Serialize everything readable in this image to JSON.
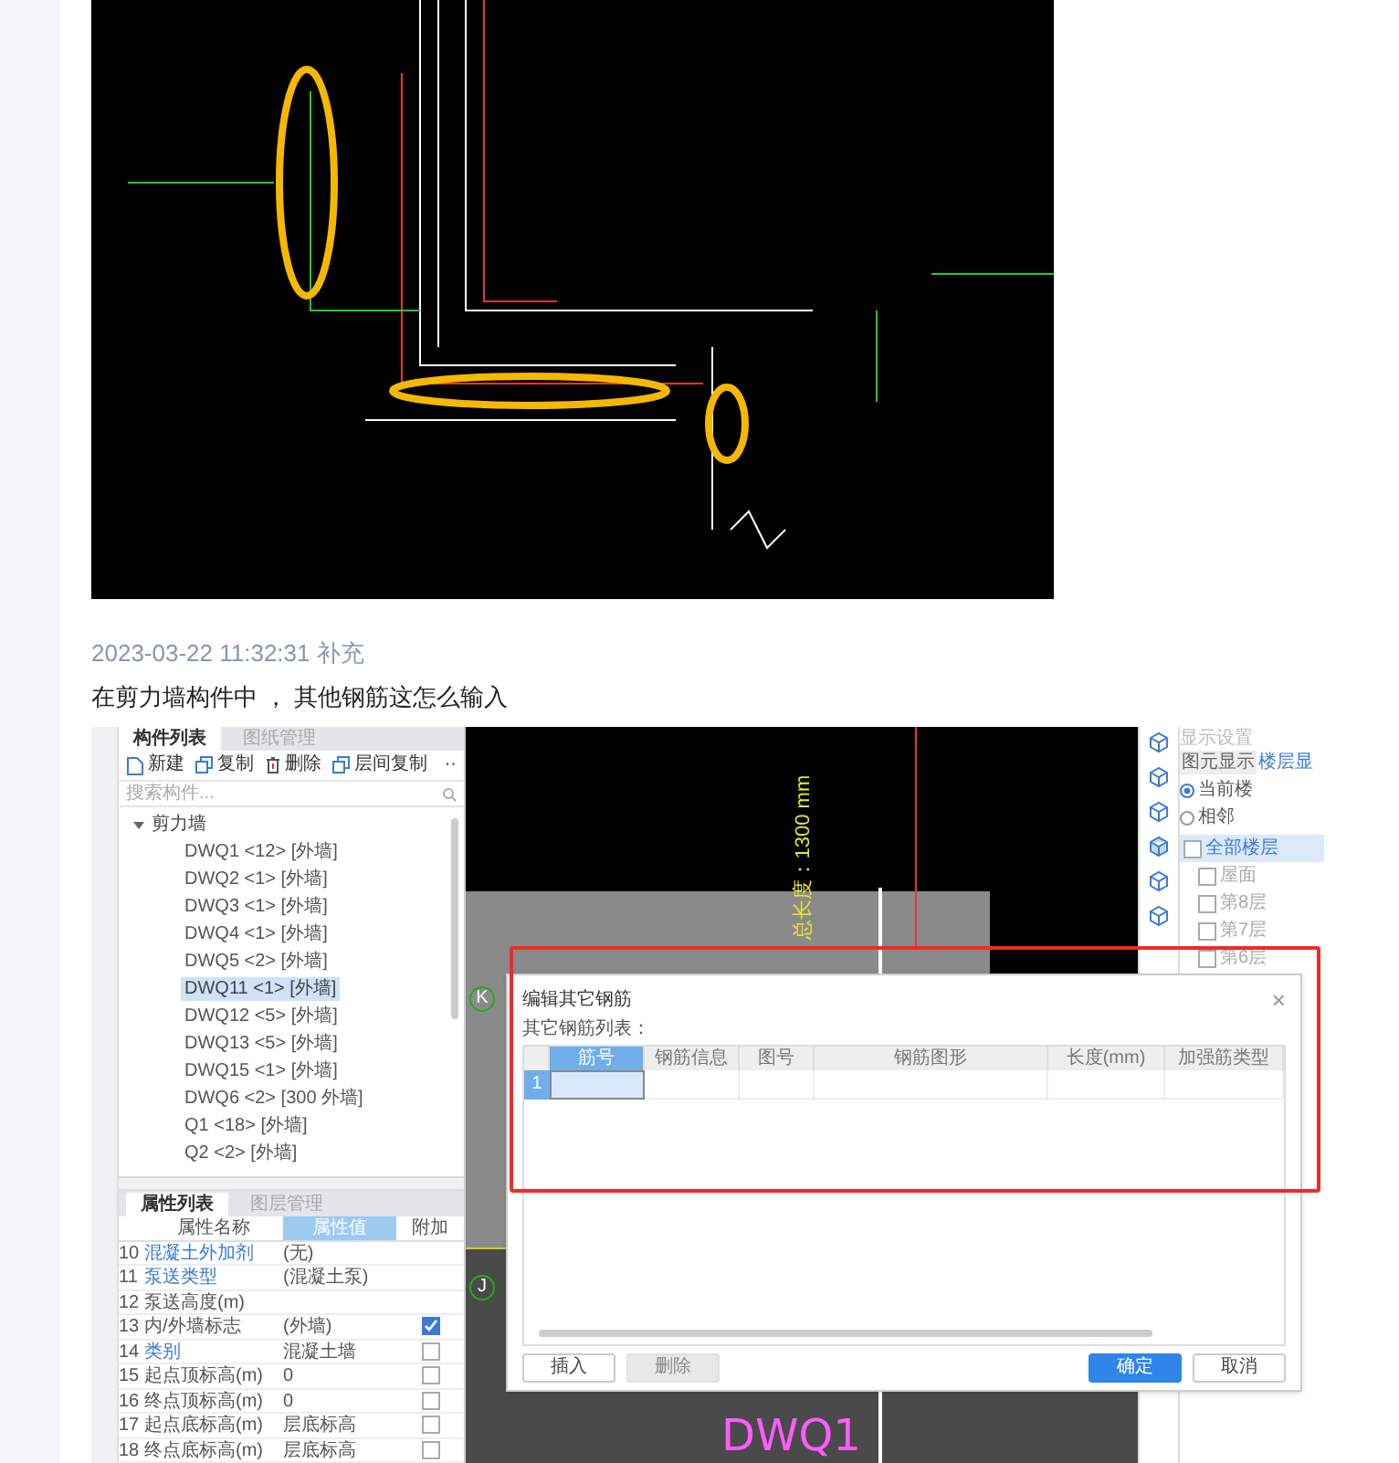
{
  "post": {
    "timestamp": "2023-03-22 11:32:31 补充",
    "question": "在剪力墙构件中 ， 其他钢筋这怎么输入"
  },
  "screenshot": {
    "left_tabs": [
      {
        "label": "构件列表",
        "selected": true
      },
      {
        "label": "图纸管理",
        "selected": false
      }
    ],
    "toolbar": [
      {
        "kind": "new",
        "label": "新建"
      },
      {
        "kind": "copy",
        "label": "复制"
      },
      {
        "kind": "delete",
        "label": "删除"
      },
      {
        "kind": "floor-copy",
        "label": "层间复制"
      },
      {
        "kind": "more",
        "label": "··"
      }
    ],
    "search": {
      "placeholder": "搜索构件..."
    },
    "tree": {
      "label": "剪力墙",
      "expanded": true,
      "children": [
        {
          "label": "DWQ1 <12> [外墙]",
          "selected": false
        },
        {
          "label": "DWQ2 <1> [外墙]",
          "selected": false
        },
        {
          "label": "DWQ3 <1> [外墙]",
          "selected": false
        },
        {
          "label": "DWQ4 <1> [外墙]",
          "selected": false
        },
        {
          "label": "DWQ5 <2> [外墙]",
          "selected": false
        },
        {
          "label": "DWQ11 <1> [外墙]",
          "selected": true
        },
        {
          "label": "DWQ12 <5> [外墙]",
          "selected": false
        },
        {
          "label": "DWQ13 <5> [外墙]",
          "selected": false
        },
        {
          "label": "DWQ15 <1> [外墙]",
          "selected": false
        },
        {
          "label": "DWQ6 <2> [300 外墙]",
          "selected": false
        },
        {
          "label": "Q1 <18> [外墙]",
          "selected": false
        },
        {
          "label": "Q2 <2> [外墙]",
          "selected": false
        }
      ]
    },
    "prop_tabs": [
      {
        "label": "属性列表",
        "selected": true
      },
      {
        "label": "图层管理",
        "selected": false
      }
    ],
    "prop_columns": [
      "属性名称",
      "属性值",
      "附加"
    ],
    "prop_rows": [
      {
        "index": "10",
        "name": "混凝土外加剂",
        "value": "(无)",
        "linked": true
      },
      {
        "index": "11",
        "name": "泵送类型",
        "value": "(混凝土泵)",
        "linked": true
      },
      {
        "index": "12",
        "name": "泵送高度(m)",
        "linked": false
      },
      {
        "index": "13",
        "name": "内/外墙标志",
        "value": "(外墙)",
        "linked": false,
        "checked": true
      },
      {
        "index": "14",
        "name": "类别",
        "value": "混凝土墙",
        "linked": true,
        "checked": false
      },
      {
        "index": "15",
        "name": "起点顶标高(m)",
        "value": "0",
        "linked": false,
        "checked": false
      },
      {
        "index": "16",
        "name": "终点顶标高(m)",
        "value": "0",
        "linked": false,
        "checked": false
      },
      {
        "index": "17",
        "name": "起点底标高(m)",
        "value": "层底标高",
        "linked": false,
        "checked": false
      },
      {
        "index": "18",
        "name": "终点底标高(m)",
        "value": "层底标高",
        "linked": false,
        "checked": false
      }
    ],
    "canvas": {
      "dimension": "总长度：1300 mm",
      "axes": [
        "K",
        "J"
      ],
      "wall_label": "DWQ1"
    },
    "right_panel": {
      "title": "显示设置",
      "tabs": [
        {
          "label": "图元显示",
          "selected": false
        },
        {
          "label": "楼层显",
          "selected": true
        }
      ],
      "radios": [
        {
          "label": "当前楼",
          "selected": true
        },
        {
          "label": "相邻",
          "selected": false
        }
      ],
      "floors": {
        "label": "全部楼层",
        "checked": false,
        "children": [
          {
            "label": "屋面",
            "checked": false
          },
          {
            "label": "第8层",
            "checked": false
          },
          {
            "label": "第7层",
            "checked": false
          },
          {
            "label": "第6层",
            "checked": false
          }
        ]
      }
    },
    "dialog": {
      "title": "编辑其它钢筋",
      "close": "×",
      "list_label": "其它钢筋列表：",
      "columns": [
        "筋号",
        "钢筋信息",
        "图号",
        "钢筋图形",
        "长度(mm)",
        "加强筋类型"
      ],
      "rows": [
        {
          "index": "1"
        }
      ],
      "buttons": [
        {
          "label": "插入",
          "kind": "default",
          "disabled": false
        },
        {
          "label": "删除",
          "kind": "default",
          "disabled": true
        },
        {
          "label": "确定",
          "kind": "primary",
          "disabled": false
        },
        {
          "label": "取消",
          "kind": "default",
          "disabled": false
        }
      ]
    }
  }
}
